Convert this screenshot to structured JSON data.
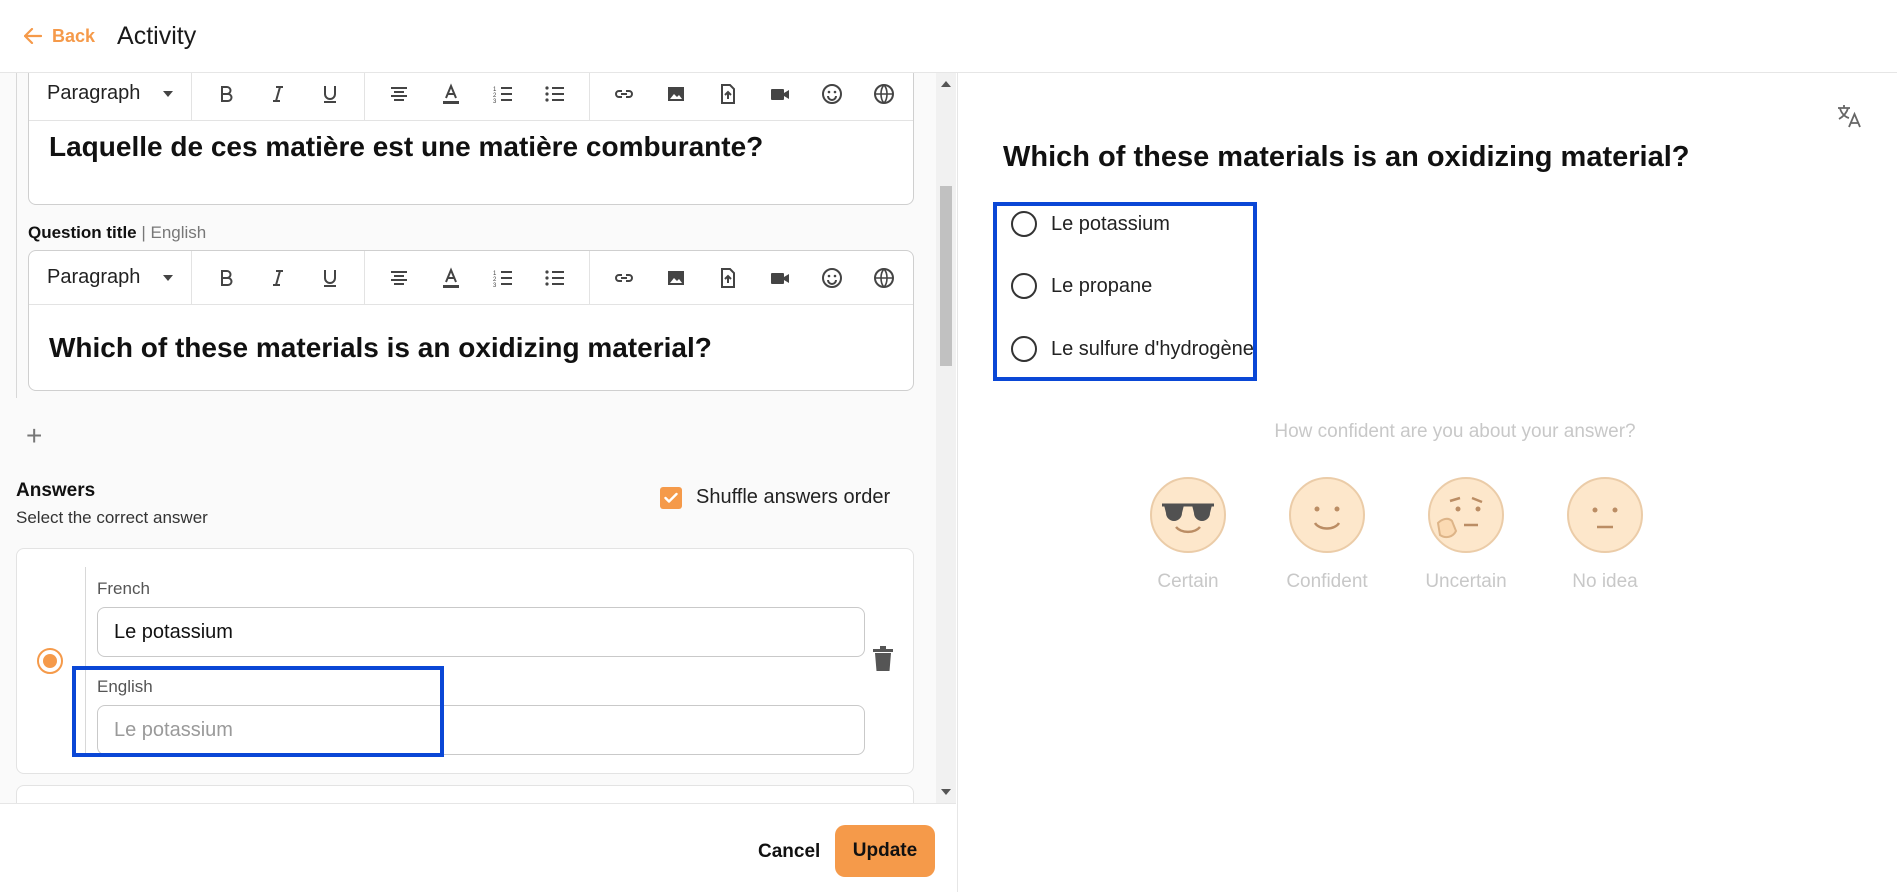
{
  "header": {
    "back_label": "Back",
    "title": "Activity"
  },
  "editor_french": {
    "format": "Paragraph",
    "content": "Laquelle de ces matière est une matière comburante?"
  },
  "editor_english": {
    "label_bold": "Question title",
    "label_sep": " | ",
    "label_lang": "English",
    "format": "Paragraph",
    "content": "Which of these materials is an oxidizing material?"
  },
  "add_symbol": "+",
  "answers": {
    "title": "Answers",
    "subtitle": "Select the correct answer",
    "shuffle_label": "Shuffle answers order",
    "card": {
      "french_label": "French",
      "french_value": "Le potassium",
      "english_label": "English",
      "english_placeholder": "Le potassium"
    }
  },
  "footer": {
    "cancel_label": "Cancel",
    "update_label": "Update"
  },
  "preview": {
    "question": "Which of these materials is an oxidizing material?",
    "options": [
      "Le potassium",
      "Le propane",
      "Le sulfure d'hydrogène"
    ],
    "confidence_question": "How confident are you about your answer?",
    "confidence_levels": [
      "Certain",
      "Confident",
      "Uncertain",
      "No idea"
    ]
  },
  "colors": {
    "accent": "#f59a4a",
    "highlight": "#0a47d6"
  }
}
